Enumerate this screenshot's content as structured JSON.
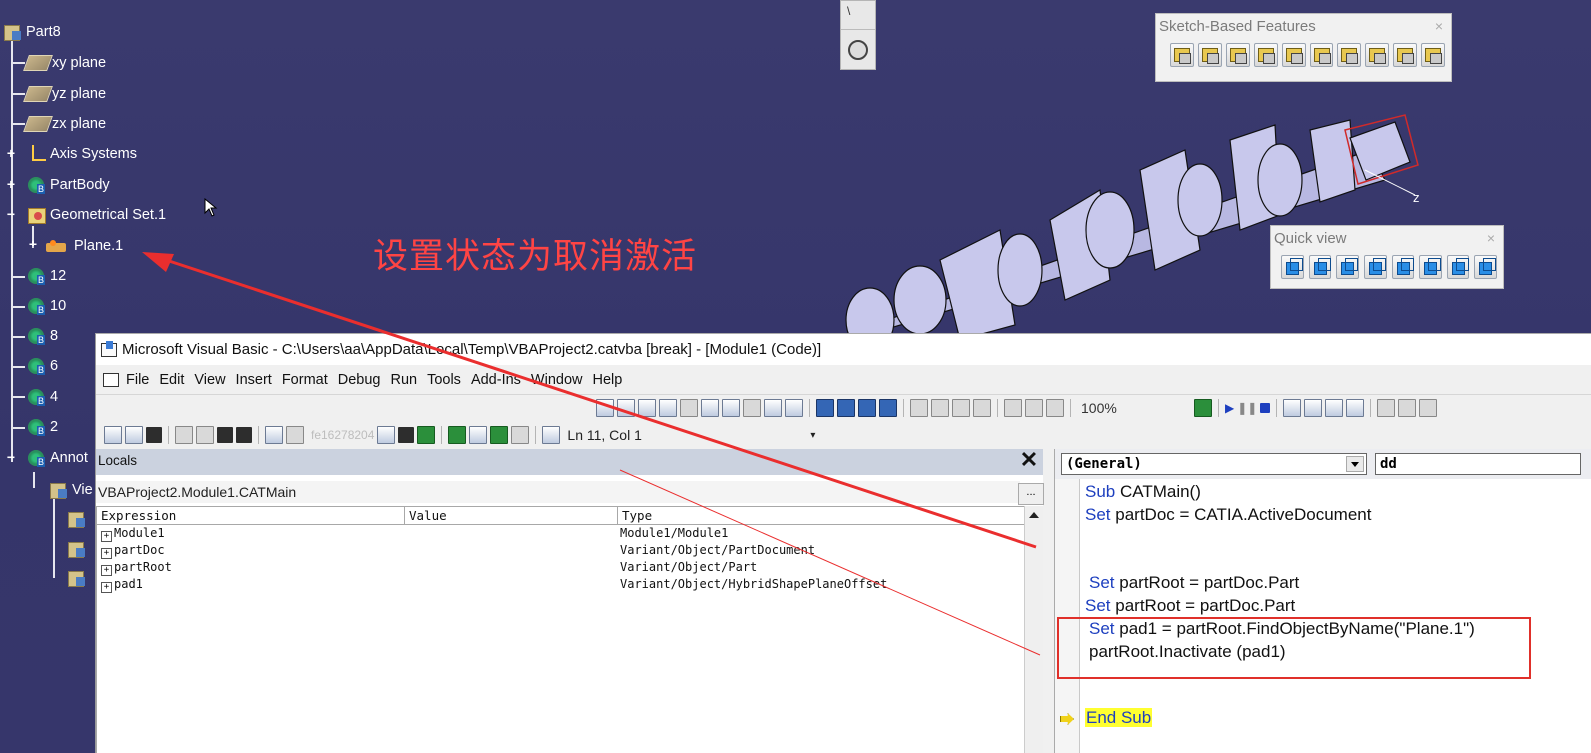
{
  "tree": {
    "root": "Part8",
    "items": [
      {
        "label": "xy plane",
        "icon": "plane-icon"
      },
      {
        "label": "yz plane",
        "icon": "plane-icon"
      },
      {
        "label": "zx plane",
        "icon": "plane-icon"
      },
      {
        "label": "Axis Systems",
        "icon": "axis-systems-icon"
      },
      {
        "label": "PartBody",
        "icon": "part-body-icon"
      },
      {
        "label": "Geometrical Set.1",
        "icon": "geometrical-set-icon"
      },
      {
        "label": "Plane.1",
        "icon": "plane-feature-icon"
      },
      {
        "label": "12",
        "icon": "body-icon"
      },
      {
        "label": "10",
        "icon": "body-icon"
      },
      {
        "label": "8",
        "icon": "body-icon"
      },
      {
        "label": "6",
        "icon": "body-icon"
      },
      {
        "label": "4",
        "icon": "body-icon"
      },
      {
        "label": "2",
        "icon": "body-icon"
      },
      {
        "label": "Annot",
        "icon": "annotation-set-icon"
      },
      {
        "label": "Vie",
        "icon": "views-icon"
      }
    ]
  },
  "toolbars": {
    "sketch_features": {
      "title": "Sketch-Based Features",
      "close": "×"
    },
    "quick_view": {
      "title": "Quick view",
      "close": "×"
    }
  },
  "annotation": {
    "text": "设置状态为取消激活",
    "color": "#ff4444"
  },
  "vb": {
    "title": "Microsoft Visual Basic - C:\\Users\\aa\\AppData\\Local\\Temp\\VBAProject2.catvba [break] - [Module1 (Code)]",
    "menu": [
      "File",
      "Edit",
      "View",
      "Insert",
      "Format",
      "Debug",
      "Run",
      "Tools",
      "Add-Ins",
      "Window",
      "Help"
    ],
    "toolbar": {
      "zoom": "100%",
      "position": "Ln 11, Col 1",
      "faded_text": "fe16278204"
    },
    "locals": {
      "title": "Locals",
      "context": "VBAProject2.Module1.CATMain",
      "context_btn": "...",
      "close": "✕",
      "columns": [
        "Expression",
        "Value",
        "Type"
      ],
      "rows": [
        {
          "expr": "Module1",
          "value": "",
          "type": "Module1/Module1"
        },
        {
          "expr": "partDoc",
          "value": "",
          "type": "Variant/Object/PartDocument"
        },
        {
          "expr": "partRoot",
          "value": "",
          "type": "Variant/Object/Part"
        },
        {
          "expr": "pad1",
          "value": "",
          "type": "Variant/Object/HybridShapePlaneOffset"
        }
      ]
    },
    "code": {
      "object_combo": "(General)",
      "proc_combo": "dd",
      "lines": [
        {
          "kw": "Sub",
          "rest": " CATMain()"
        },
        {
          "kw": "Set",
          "rest": " partDoc = CATIA.ActiveDocument"
        },
        {
          "kw": "Set",
          "rest": " partRoot = partDoc.Part"
        },
        {
          "kw": "Set",
          "rest": " partRoot = partDoc.Part"
        },
        {
          "kw": "Set",
          "rest": " pad1 = partRoot.FindObjectByName(\"Plane.1\")"
        },
        {
          "kw": "",
          "rest": "partRoot.Inactivate (pad1)"
        },
        {
          "kw": "End Sub",
          "rest": ""
        }
      ]
    }
  },
  "colors": {
    "background": "#38386a",
    "annotation": "#ff4444",
    "highlight": "#ffff30",
    "keyword": "#1d3fbf"
  }
}
